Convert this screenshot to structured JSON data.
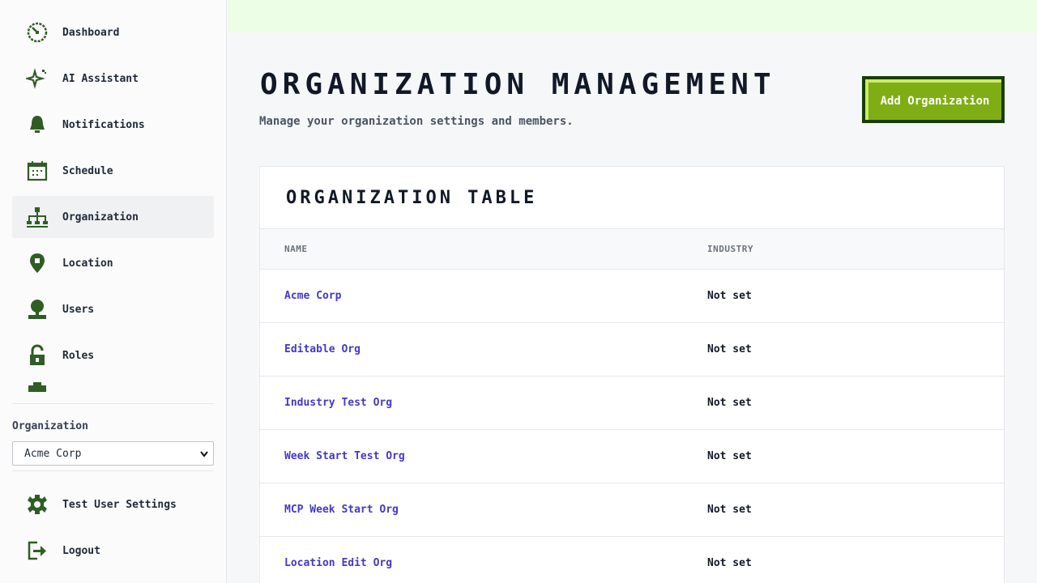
{
  "sidebar": {
    "nav": [
      {
        "label": "Dashboard",
        "icon": "dashboard-icon"
      },
      {
        "label": "AI Assistant",
        "icon": "sparkle-icon"
      },
      {
        "label": "Notifications",
        "icon": "bell-icon"
      },
      {
        "label": "Schedule",
        "icon": "calendar-icon"
      },
      {
        "label": "Organization",
        "icon": "org-chart-icon",
        "active": true
      },
      {
        "label": "Location",
        "icon": "map-pin-icon"
      },
      {
        "label": "Users",
        "icon": "user-icon"
      },
      {
        "label": "Roles",
        "icon": "lock-icon"
      }
    ],
    "org_switcher": {
      "label": "Organization",
      "selected": "Acme Corp"
    },
    "bottom": {
      "settings_label": "Test User Settings",
      "logout_label": "Logout"
    }
  },
  "header": {
    "title": "Organization Management",
    "subtitle": "Manage your organization settings and members.",
    "add_button_label": "Add Organization"
  },
  "table": {
    "title": "Organization Table",
    "columns": [
      "NAME",
      "INDUSTRY"
    ],
    "rows": [
      {
        "name": "Acme Corp",
        "industry": "Not set"
      },
      {
        "name": "Editable Org",
        "industry": "Not set"
      },
      {
        "name": "Industry Test Org",
        "industry": "Not set"
      },
      {
        "name": "Week Start Test Org",
        "industry": "Not set"
      },
      {
        "name": "MCP Week Start Org",
        "industry": "Not set"
      },
      {
        "name": "Location Edit Org",
        "industry": "Not set"
      }
    ]
  },
  "colors": {
    "icon_green": "#2f5d24",
    "accent_button": "#7fae14",
    "link": "#4338ca",
    "topbar": "#ecffe6"
  }
}
